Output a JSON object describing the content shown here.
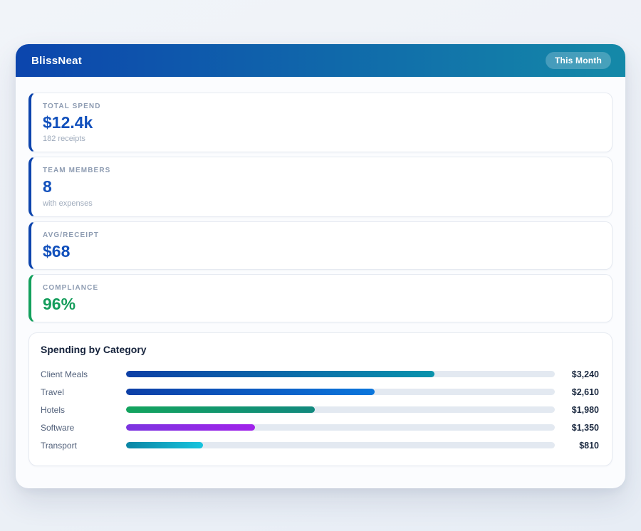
{
  "app": {
    "title": "BlissNeat",
    "period_badge": "This Month"
  },
  "colors": {
    "header_gradient_start": "#0c45ad",
    "header_gradient_end": "#1489a8",
    "accent_blue": "#0e45ad",
    "accent_green": "#13a05c",
    "value_blue": "#1150bc",
    "value_green": "#149d5b",
    "bar_track": "#e3e9f1"
  },
  "stats": [
    {
      "label": "TOTAL SPEND",
      "value": "$12.4k",
      "sub": "182 receipts",
      "accent": "#0e45ad",
      "value_color": "#1150bc"
    },
    {
      "label": "TEAM MEMBERS",
      "value": "8",
      "sub": "with expenses",
      "accent": "#0e45ad",
      "value_color": "#1150bc"
    },
    {
      "label": "AVG/RECEIPT",
      "value": "$68",
      "sub": "",
      "accent": "#0e45ad",
      "value_color": "#1150bc"
    },
    {
      "label": "COMPLIANCE",
      "value": "96%",
      "sub": "",
      "accent": "#13a05c",
      "value_color": "#149d5b"
    }
  ],
  "chart_data": {
    "type": "bar",
    "orientation": "horizontal",
    "title": "Spending by Category",
    "categories": [
      "Client Meals",
      "Travel",
      "Hotels",
      "Software",
      "Transport"
    ],
    "values": [
      3240,
      2610,
      1980,
      1350,
      810
    ],
    "value_labels": [
      "$3,240",
      "$2,610",
      "$1,980",
      "$1,350",
      "$810"
    ],
    "axis_max": 4500,
    "bar_gradients": [
      [
        "#0d3fa6",
        "#0a93ac"
      ],
      [
        "#0d3fa6",
        "#0b76dc"
      ],
      [
        "#13a45e",
        "#12897e"
      ],
      [
        "#7c35e0",
        "#a123ea"
      ],
      [
        "#0b85a4",
        "#17c4de"
      ]
    ]
  }
}
